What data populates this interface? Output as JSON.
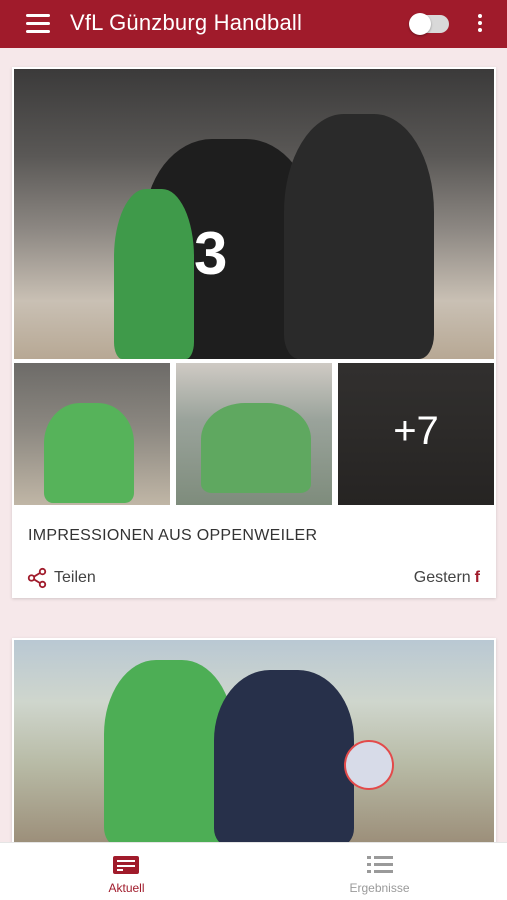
{
  "appbar": {
    "title": "VfL Günzburg Handball"
  },
  "feed": {
    "post1": {
      "title": "IMPRESSIONEN AUS OPPENWEILER",
      "more_photos": "+7",
      "share_label": "Teilen",
      "date_label": "Gestern",
      "source_icon": "facebook-icon"
    }
  },
  "bottom_nav": {
    "items": [
      {
        "label": "Aktuell",
        "icon": "newspaper-icon",
        "active": true
      },
      {
        "label": "Ergebnisse",
        "icon": "list-icon",
        "active": false
      }
    ]
  },
  "colors": {
    "brand": "#a01b2b",
    "background": "#f6e8ea",
    "inactive": "#9a9a9a"
  }
}
